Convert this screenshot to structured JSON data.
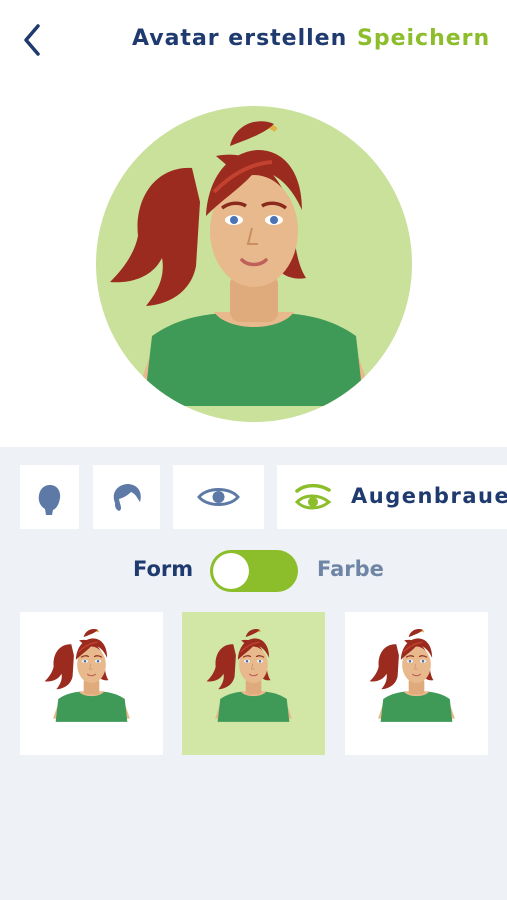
{
  "header": {
    "title": "Avatar erstellen",
    "save_label": "Speichern",
    "back_icon": "chevron-left-icon"
  },
  "categories": [
    {
      "icon": "head-shape-icon",
      "label": "",
      "selected": false
    },
    {
      "icon": "hair-icon",
      "label": "",
      "selected": false
    },
    {
      "icon": "eye-icon",
      "label": "",
      "selected": false
    },
    {
      "icon": "eyebrow-icon",
      "label": "Augenbrauen",
      "selected": true
    }
  ],
  "mode_toggle": {
    "left_label": "Form",
    "right_label": "Farbe",
    "state": "on"
  },
  "options": {
    "selected_index": 1,
    "count": 3
  },
  "colors": {
    "primary": "#1f3a6e",
    "accent": "#8cbd2a",
    "editor_background": "#eef1f5",
    "selected_option_background": "#d2e6a6",
    "avatar_background": "#c9e19a",
    "shirt": "#3f9a58",
    "hair": "#9a2b1e",
    "skin": "#e8b98c"
  }
}
